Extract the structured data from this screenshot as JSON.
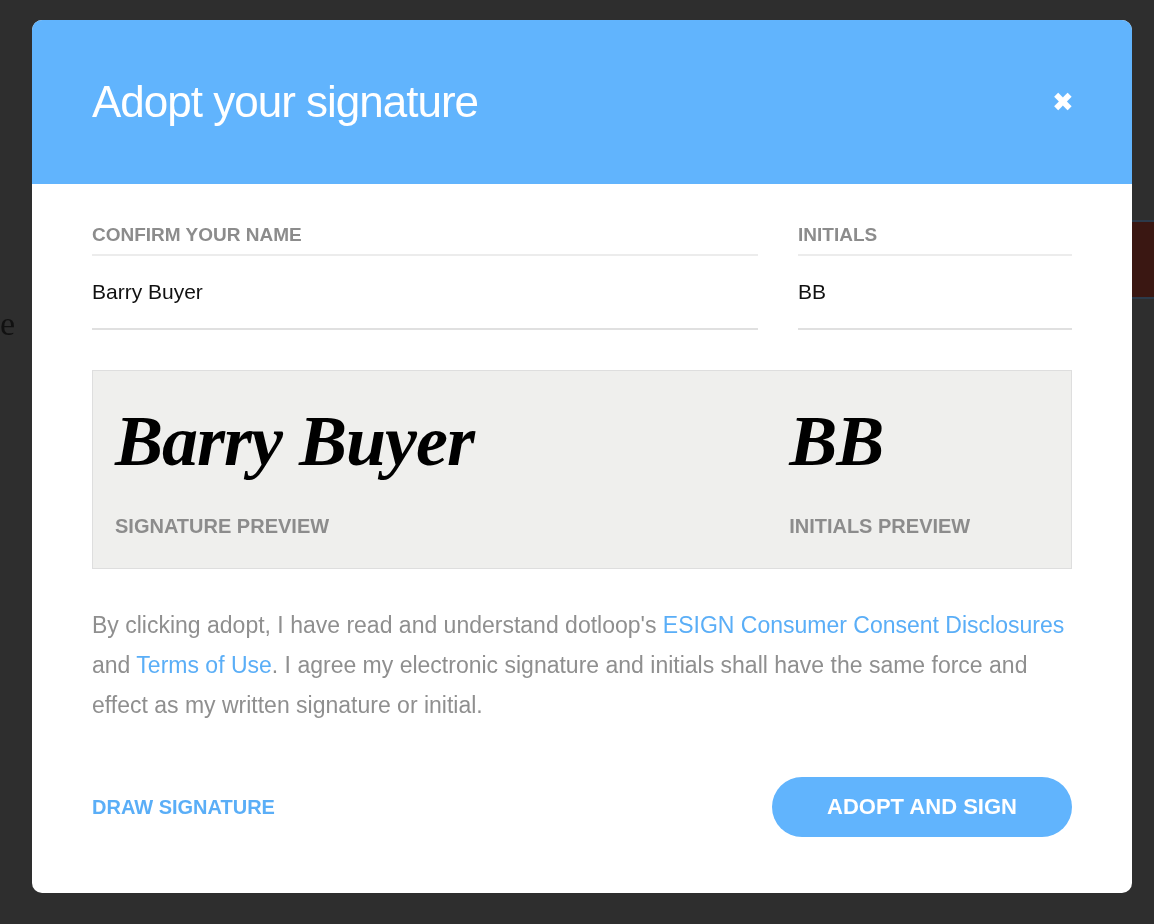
{
  "background": {
    "fragment": "e"
  },
  "dialog": {
    "title": "Adopt your signature",
    "close": "✖"
  },
  "fields": [
    {
      "label": "CONFIRM YOUR NAME",
      "value": "Barry Buyer"
    },
    {
      "label": "INITIALS",
      "value": "BB"
    }
  ],
  "previews": [
    {
      "text": "Barry Buyer",
      "label": "SIGNATURE PREVIEW"
    },
    {
      "text": "BB",
      "label": "INITIALS PREVIEW"
    }
  ],
  "consent": [
    {
      "kind": "text",
      "text": "By clicking adopt, I have read and understand dotloop's "
    },
    {
      "kind": "link",
      "text": "ESIGN Consumer Consent Disclosures"
    },
    {
      "kind": "text",
      "text": " and "
    },
    {
      "kind": "link",
      "text": "Terms of Use"
    },
    {
      "kind": "text",
      "text": ". I agree my electronic signature and initials shall have the same force and effect as my written signature or initial."
    }
  ],
  "footer": {
    "link": "DRAW SIGNATURE",
    "button": "ADOPT AND SIGN"
  }
}
